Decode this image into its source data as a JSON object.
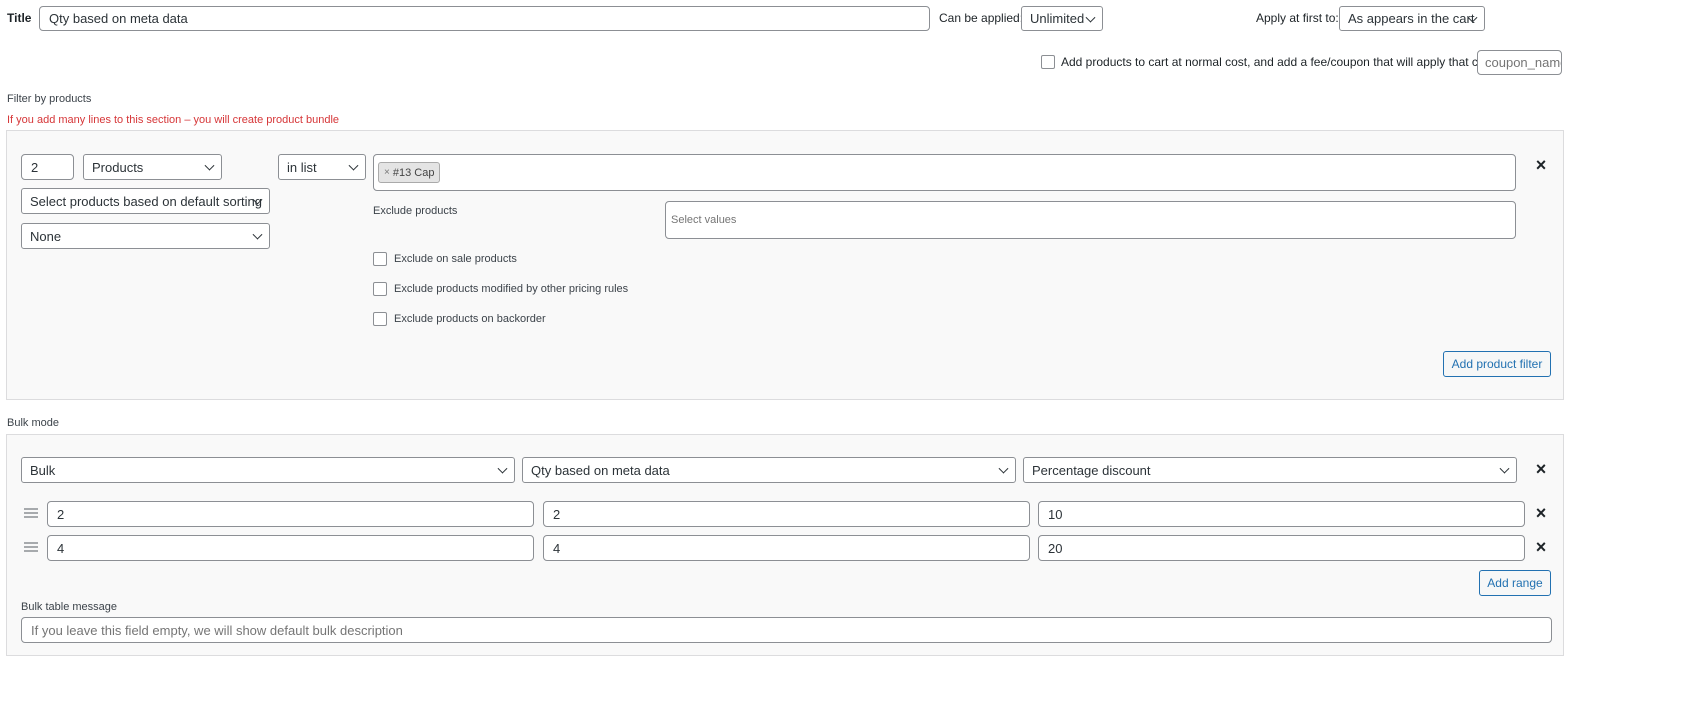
{
  "header": {
    "title_label": "Title",
    "title_value": "Qty based on meta data",
    "can_be_applied_label": "Can be applied:",
    "can_be_applied_value": "Unlimited",
    "apply_first_label": "Apply at first to:",
    "apply_first_value": "As appears in the cart",
    "add_fee_label": "Add products to cart at normal cost, and add a fee/coupon that will apply that cost",
    "coupon_placeholder": "coupon_name"
  },
  "filter": {
    "section_label": "Filter by products",
    "warning": "If you add many lines to this section – you will create product bundle",
    "qty_value": "2",
    "type_value": "Products",
    "method_value": "in list",
    "selected_tag": "#13 Cap",
    "sorting_value": "Select products based on default sorting",
    "none_value": "None",
    "exclude_label": "Exclude products",
    "exclude_placeholder": "Select values",
    "exclude_on_sale": "Exclude on sale products",
    "exclude_modified": "Exclude products modified by other pricing rules",
    "exclude_backorder": "Exclude products on backorder",
    "add_filter_button": "Add product filter"
  },
  "bulk": {
    "section_label": "Bulk mode",
    "mode_value": "Bulk",
    "measure_value": "Qty based on meta data",
    "discount_type_value": "Percentage discount",
    "ranges": [
      {
        "from": "2",
        "to": "2",
        "value": "10"
      },
      {
        "from": "4",
        "to": "4",
        "value": "20"
      }
    ],
    "add_range_button": "Add range",
    "table_message_label": "Bulk table message",
    "table_message_placeholder": "If you leave this field empty, we will show default bulk description"
  },
  "colors": {
    "accent": "#2271b1",
    "warning": "#d63638"
  }
}
